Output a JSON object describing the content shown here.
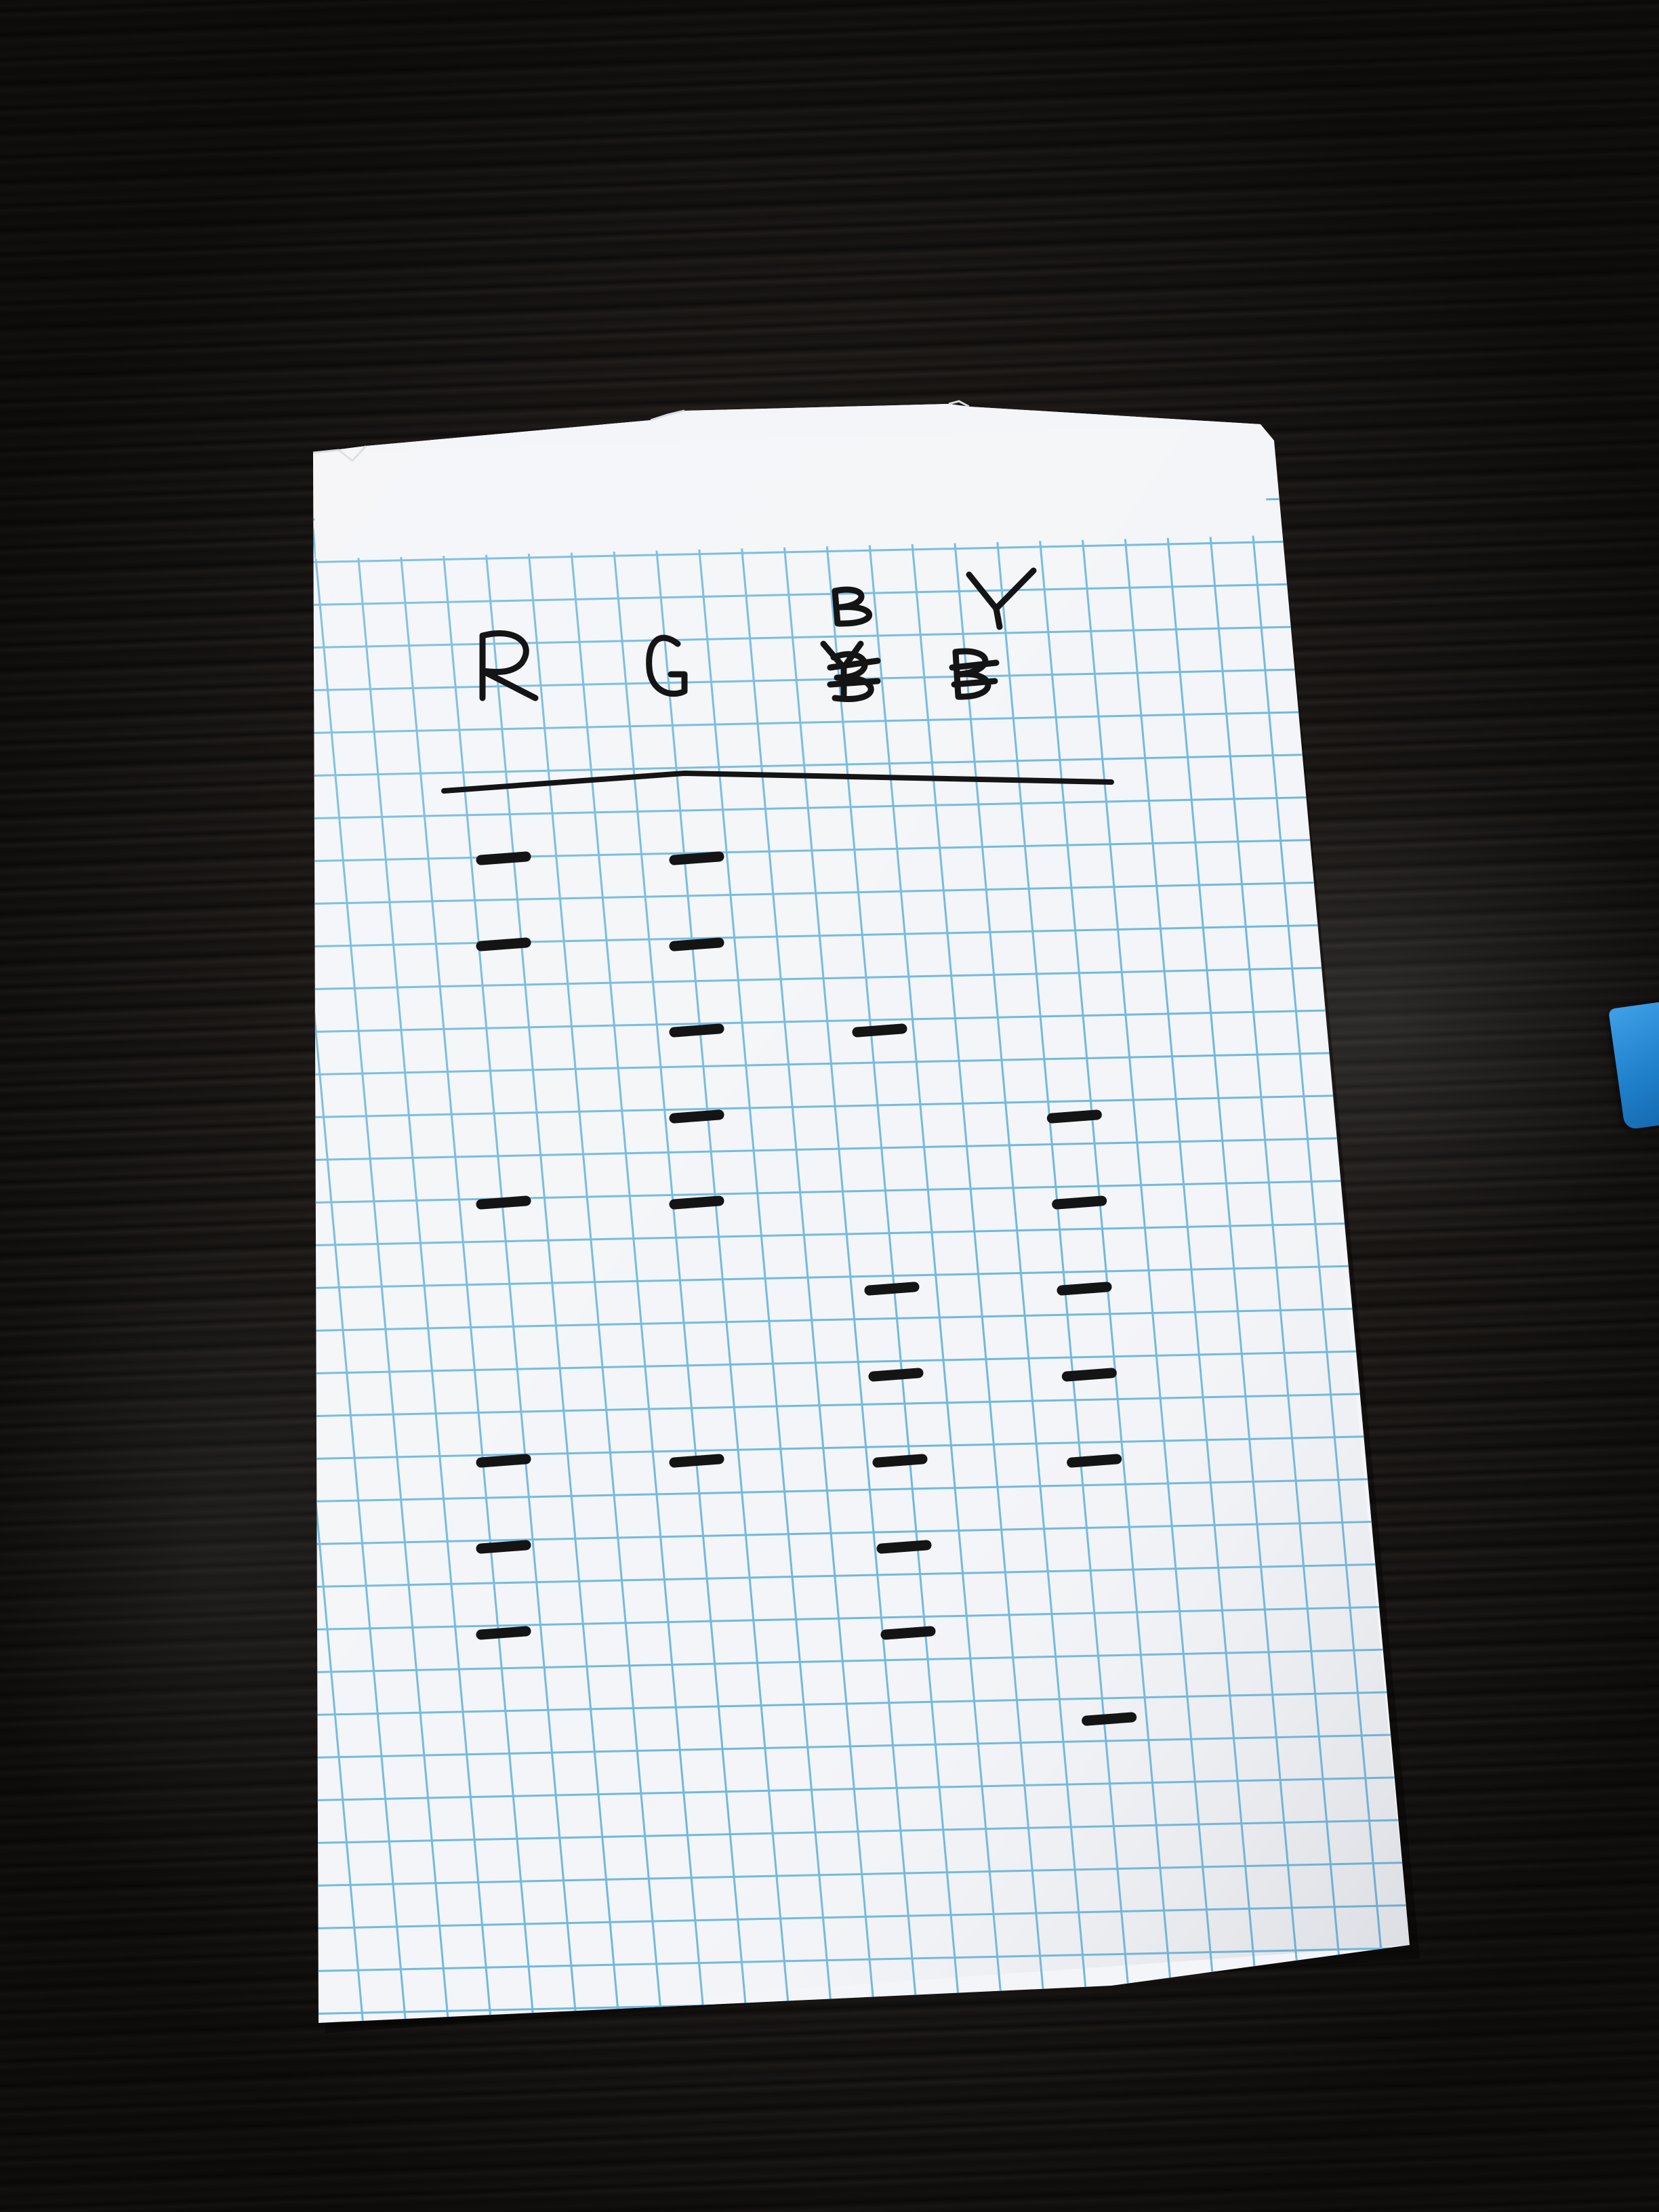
{
  "scene": {
    "description_free": true,
    "paper_color": "#f4f5f8",
    "grid_color": "#6fb8e0",
    "ink_color": "#141414",
    "tape_color": "#2b8fd8"
  },
  "labels": {
    "col1": "R",
    "col2": "G",
    "col3_top": "B",
    "col3_crossed": "Y",
    "col4_top": "Y",
    "col4_crossed": "B"
  },
  "bands": {
    "R": [
      1,
      2,
      5,
      8,
      9,
      10
    ],
    "G": [
      1,
      2,
      3,
      4,
      5,
      8
    ],
    "B": [
      3,
      6,
      7,
      8,
      9,
      10
    ],
    "Y": [
      4,
      5,
      6,
      7,
      8,
      11
    ]
  }
}
